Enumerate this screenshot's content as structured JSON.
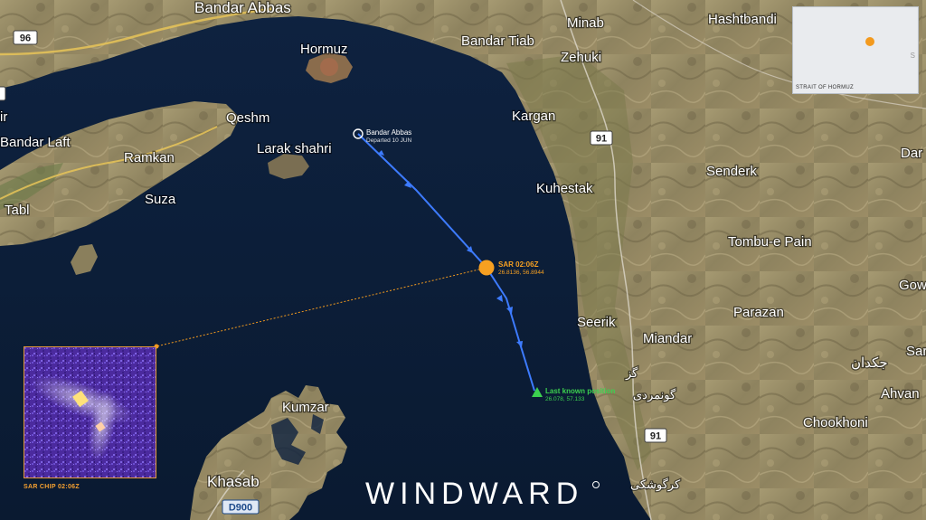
{
  "places": {
    "bandar_abbas": "Bandar Abbas",
    "hormuz": "Hormuz",
    "bandar_tiab": "Bandar Tiab",
    "minab": "Minab",
    "hashtbandi": "Hashtbandi",
    "zehuki": "Zehuki",
    "qeshm": "Qeshm",
    "bandar_laft": "Bandar Laft",
    "ramkan": "Ramkan",
    "suza": "Suza",
    "tabl": "Tabl",
    "larak": "Larak shahri",
    "kargan": "Kargan",
    "kuhestak": "Kuhestak",
    "senderk": "Senderk",
    "tombu": "Tombu-e Pain",
    "parazan": "Parazan",
    "seerik": "Seerik",
    "miandar": "Miandar",
    "kumzar": "Kumzar",
    "khasab": "Khasab",
    "chookhoni": "Chookhoni",
    "ahvan": "Ahvan",
    "gow": "Gow",
    "sar": "Sar",
    "dar": "Dar",
    "mir": "ir",
    "persian1": "جکدان",
    "persian2": "گز",
    "persian3": "گونمردی",
    "persian4": "کرگوشکی"
  },
  "roads": {
    "r96": "96",
    "r91a": "91",
    "r91b": "91",
    "d900": "D900"
  },
  "track": {
    "origin_name": "Bandar Abbas",
    "origin_departed": "Departed 10 JUN",
    "sar_label": "SAR 02:06Z",
    "sar_coords": "26.8136, 56.8944",
    "last_label": "Last known position",
    "last_coords": "26.078, 57.133",
    "track_color": "#3d7bff",
    "sar_color": "#f7a021",
    "last_color": "#3cd14f"
  },
  "inset": {
    "label": "STRAIT OF HORMUZ",
    "corner": "S"
  },
  "sar_chip": {
    "caption": "SAR CHIP 02:06Z"
  },
  "brand": "WINDWARD"
}
